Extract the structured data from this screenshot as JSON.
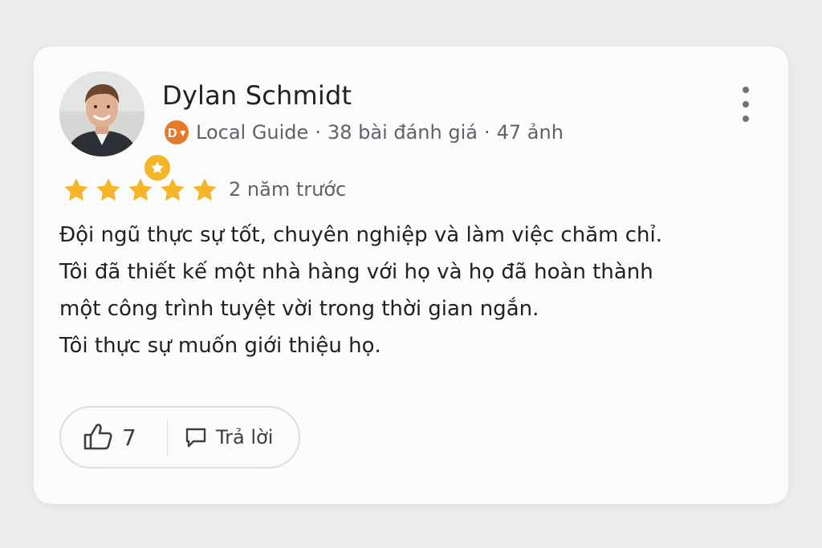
{
  "reviewer": {
    "name": "Dylan Schmidt",
    "badge_initial": "D",
    "guide_label": "Local Guide",
    "separator": "·",
    "reviews_count": "38 bài đánh giá",
    "photos_count": "47 ảnh"
  },
  "rating": {
    "stars": 5,
    "max": 5,
    "time_ago": "2 năm trước"
  },
  "review_lines": [
    "Đội ngũ thực sự tốt, chuyên nghiệp và làm việc chăm chỉ.",
    "Tôi đã thiết kế một nhà hàng với họ và họ đã hoàn thành",
    "một công trình tuyệt vời trong thời gian ngắn.",
    "Tôi thực sự muốn giới thiệu họ."
  ],
  "actions": {
    "like_count": "7",
    "reply_label": "Trả lời"
  },
  "icons": {
    "menu": "more-vert-icon",
    "like": "thumbs-up-icon",
    "reply": "comment-icon",
    "star": "star-icon",
    "guide_badge": "star-badge-icon"
  },
  "colors": {
    "star": "#f6b526",
    "local_guide_orange": "#e37b2a",
    "text_primary": "#202124",
    "text_secondary": "#5f6368"
  }
}
